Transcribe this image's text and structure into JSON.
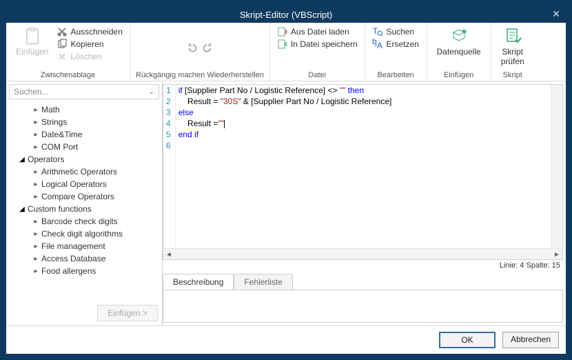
{
  "title": "Skript-Editor (VBScript)",
  "ribbon": {
    "paste": "Einfügen",
    "cut": "Ausschneiden",
    "copy": "Kopieren",
    "delete": "Löschen",
    "group_clipboard": "Zwischenablage",
    "group_undo": "Rückgängig machen Wiederherstellen",
    "load_file": "Aus Datei laden",
    "save_file": "In Datei speichern",
    "group_file": "Datei",
    "search": "Suchen",
    "replace": "Ersetzen",
    "group_edit": "Bearbeiten",
    "datasource": "Datenquelle",
    "group_insert": "Einfügen",
    "check_script_l1": "Skript",
    "check_script_l2": "prüfen",
    "group_script": "Skript"
  },
  "search_placeholder": "Suchen...",
  "tree": {
    "math": "Math",
    "strings": "Strings",
    "datetime": "Date&Time",
    "comport": "COM Port",
    "operators": "Operators",
    "arith": "Arithmetic Operators",
    "logical": "Logical Operators",
    "compare": "Compare Operators",
    "custom": "Custom functions",
    "barcode": "Barcode check digits",
    "checkdigit": "Check digit algorithms",
    "filemgmt": "File management",
    "access": "Access Database",
    "allergens": "Food allergens"
  },
  "insert_btn": "Einfügen >",
  "code": {
    "l1a": "if",
    "l1b_t": " [Supplier Part No / Logistic Reference] <> ",
    "l1b_s": "\"\"",
    "l1c": " then",
    "l2a": "    Result = ",
    "l2b": "\"30S\"",
    "l2c": " & [Supplier Part No / Logistic Reference]",
    "l3": "else",
    "l4a": "    Result =",
    "l4b": "\"\"",
    "l5": "end if",
    "gutter": [
      "1",
      "2",
      "3",
      "4",
      "5",
      "6"
    ]
  },
  "status": "Linie: 4 Spalte: 15",
  "tabs": {
    "desc": "Beschreibung",
    "errors": "Fehlerliste"
  },
  "footer": {
    "ok": "OK",
    "cancel": "Abbrechen"
  }
}
